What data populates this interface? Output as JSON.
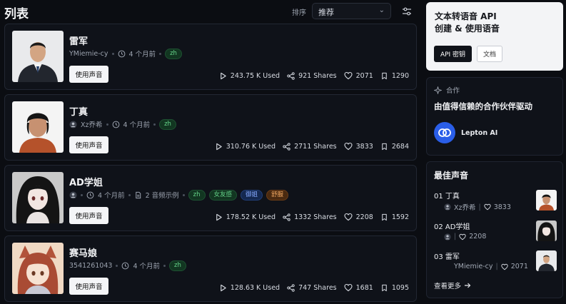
{
  "header": {
    "title": "列表",
    "sort_label": "排序",
    "sort_value": "推荐"
  },
  "voices": [
    {
      "name": "雷军",
      "author": "YMiemie-cy",
      "time": "4 个月前",
      "tags": [
        {
          "text": "zh",
          "color": "green"
        }
      ],
      "use_label": "使用声音",
      "used": "243.75 K Used",
      "shares": "921 Shares",
      "likes": "2071",
      "saves": "1290"
    },
    {
      "name": "丁真",
      "author": "Xz乔希",
      "time": "4 个月前",
      "tags": [
        {
          "text": "zh",
          "color": "green"
        }
      ],
      "use_label": "使用声音",
      "used": "310.76 K Used",
      "shares": "2711 Shares",
      "likes": "3833",
      "saves": "2684"
    },
    {
      "name": "AD学姐",
      "author": "",
      "time": "4 个月前",
      "samples": "2 音频示例",
      "tags": [
        {
          "text": "zh",
          "color": "green"
        },
        {
          "text": "女友感",
          "color": "green"
        },
        {
          "text": "御姐",
          "color": "blue"
        },
        {
          "text": "舒服",
          "color": "orange"
        }
      ],
      "use_label": "使用声音",
      "used": "178.52 K Used",
      "shares": "1332 Shares",
      "likes": "2208",
      "saves": "1592"
    },
    {
      "name": "赛马娘",
      "author": "3541261043",
      "time": "4 个月前",
      "tags": [
        {
          "text": "zh",
          "color": "green"
        }
      ],
      "use_label": "使用声音",
      "used": "128.63 K Used",
      "shares": "747 Shares",
      "likes": "1681",
      "saves": "1095"
    }
  ],
  "tts_promo": {
    "title": "文本转语音 API",
    "subtitle": "创建 & 使用语音",
    "primary_label": "API 密钥",
    "secondary_label": "文档"
  },
  "partner": {
    "label": "合作",
    "title": "由值得信赖的合作伙伴驱动",
    "partner_name": "Lepton AI"
  },
  "best_voices": {
    "title": "最佳声音",
    "items": [
      {
        "name": "01 丁真",
        "author": "Xz乔希",
        "likes": "3833"
      },
      {
        "name": "02 AD学姐",
        "author": "",
        "likes": "2208"
      },
      {
        "name": "03 雷军",
        "author": "YMiemie-cy",
        "likes": "2071"
      }
    ],
    "see_more": "查看更多"
  },
  "colors": {
    "tag_green": "#66d48a",
    "tag_blue": "#86a9ff",
    "tag_orange": "#f3a963",
    "lepton_blue": "#2a5ee8"
  }
}
